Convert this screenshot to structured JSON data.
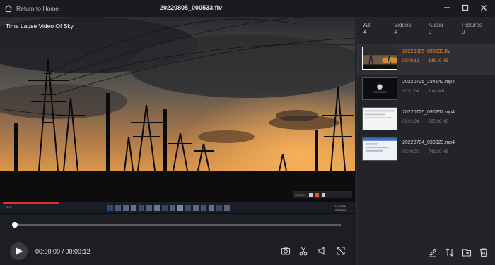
{
  "titlebar": {
    "home_label": "Return to Home",
    "file_title": "20220805_000533.flv"
  },
  "video": {
    "overlay_title": "Time Lapse Video Of Sky",
    "mini_time": "00:00:00",
    "taskbar_weather": "28°C",
    "taskbar_time": "12:03 AM",
    "taskbar_date": "8/5/2022"
  },
  "player": {
    "time_display": "00:00:00 / 00:00:12",
    "progress": 0.0
  },
  "panel": {
    "tabs": [
      {
        "label": "All",
        "count": "4"
      },
      {
        "label": "Videos",
        "count": "4"
      },
      {
        "label": "Audio",
        "count": "0"
      },
      {
        "label": "Pictures",
        "count": "0"
      }
    ],
    "files": [
      {
        "name": "20220805_000533.flv",
        "duration": "00:00:12",
        "size": "146.19 KB",
        "selected": true
      },
      {
        "name": "20220725_234142.mp4",
        "duration": "00:01:04",
        "size": "1.64 MB",
        "selected": false
      },
      {
        "name": "20220725_090252.mp4",
        "duration": "00:01:34",
        "size": "205.96 KB",
        "selected": false
      },
      {
        "name": "20220704_033023.mp4",
        "duration": "00:00:20",
        "size": "743.30 KB",
        "selected": false
      }
    ]
  },
  "icons": {
    "home": "home-icon",
    "minimize": "minimize-icon",
    "maximize": "maximize-icon",
    "close": "close-icon",
    "play": "play-icon",
    "screenshot": "camera-icon",
    "cut": "scissors-icon",
    "volume": "volume-icon",
    "fullscreen": "fullscreen-icon",
    "rename": "rename-icon",
    "sort": "sort-icon",
    "open_folder": "folder-icon",
    "delete": "trash-icon"
  },
  "colors": {
    "accent": "#f08a2b",
    "background": "#1d1e22",
    "panel": "#232428"
  }
}
